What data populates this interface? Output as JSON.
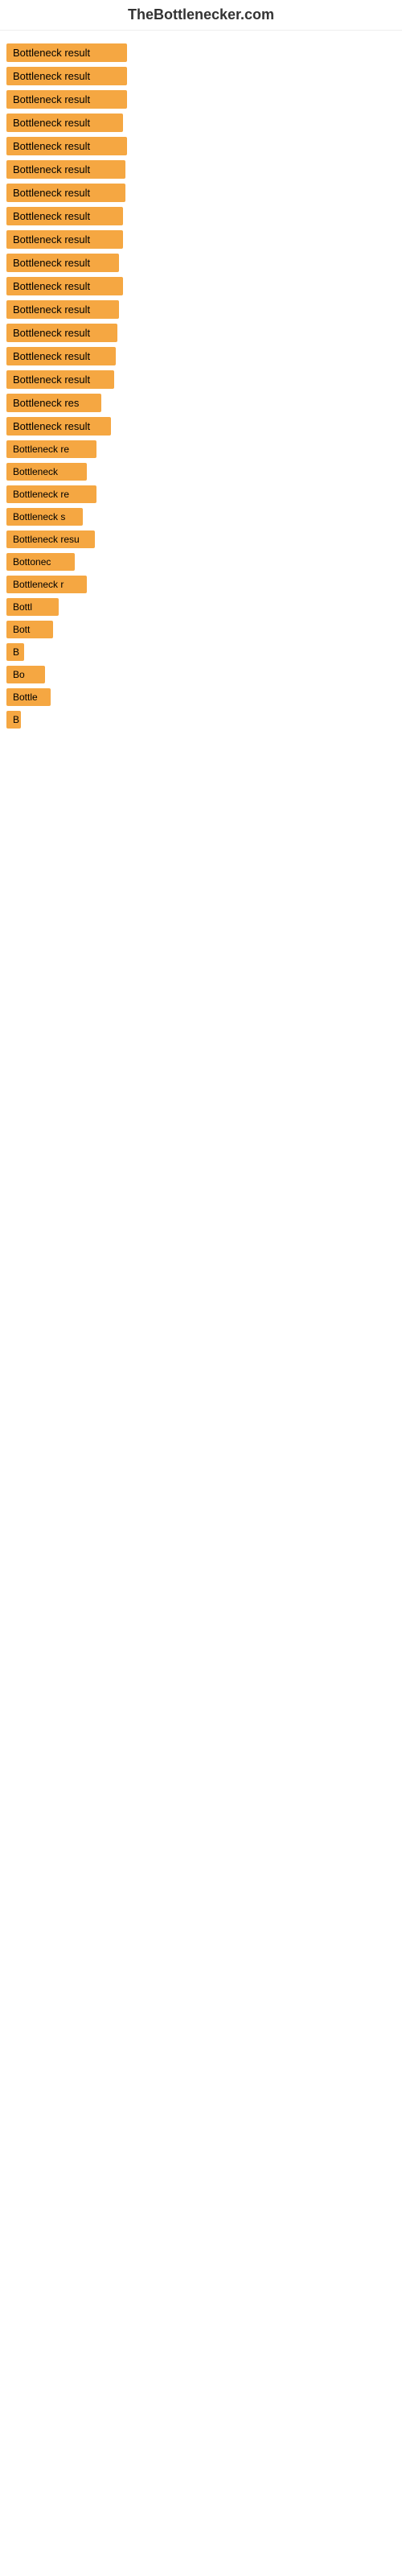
{
  "page": {
    "title": "TheBottlenecker.com"
  },
  "items": [
    {
      "id": 1,
      "label": "Bottleneck result"
    },
    {
      "id": 2,
      "label": "Bottleneck result"
    },
    {
      "id": 3,
      "label": "Bottleneck result"
    },
    {
      "id": 4,
      "label": "Bottleneck result"
    },
    {
      "id": 5,
      "label": "Bottleneck result"
    },
    {
      "id": 6,
      "label": "Bottleneck result"
    },
    {
      "id": 7,
      "label": "Bottleneck result"
    },
    {
      "id": 8,
      "label": "Bottleneck result"
    },
    {
      "id": 9,
      "label": "Bottleneck result"
    },
    {
      "id": 10,
      "label": "Bottleneck result"
    },
    {
      "id": 11,
      "label": "Bottleneck result"
    },
    {
      "id": 12,
      "label": "Bottleneck result"
    },
    {
      "id": 13,
      "label": "Bottleneck result"
    },
    {
      "id": 14,
      "label": "Bottleneck result"
    },
    {
      "id": 15,
      "label": "Bottleneck result"
    },
    {
      "id": 16,
      "label": "Bottleneck res"
    },
    {
      "id": 17,
      "label": "Bottleneck result"
    },
    {
      "id": 18,
      "label": "Bottleneck re"
    },
    {
      "id": 19,
      "label": "Bottleneck"
    },
    {
      "id": 20,
      "label": "Bottleneck re"
    },
    {
      "id": 21,
      "label": "Bottleneck s"
    },
    {
      "id": 22,
      "label": "Bottleneck resu"
    },
    {
      "id": 23,
      "label": "Bottonec"
    },
    {
      "id": 24,
      "label": "Bottleneck r"
    },
    {
      "id": 25,
      "label": "Bottl"
    },
    {
      "id": 26,
      "label": "Bott"
    },
    {
      "id": 27,
      "label": "B"
    },
    {
      "id": 28,
      "label": "Bo"
    },
    {
      "id": 29,
      "label": "Bottle"
    },
    {
      "id": 30,
      "label": "B"
    }
  ]
}
